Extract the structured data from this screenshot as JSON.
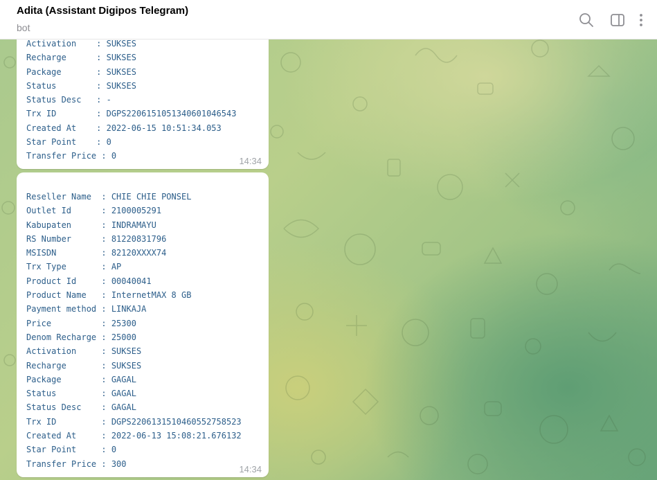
{
  "header": {
    "title": "Adita (Assistant Digipos Telegram)",
    "subtitle": "bot",
    "icons": {
      "search": "search-icon",
      "sidebar": "sidebar-toggle-icon",
      "more": "more-vertical-icon"
    }
  },
  "colors": {
    "message_text": "#2c5e8a",
    "bubble": "#ffffff",
    "time": "#a0a4a8",
    "background_light": "#cfd79a",
    "background_dark": "#5f9e74"
  },
  "messages": [
    {
      "lines": [
        "Activation    : SUKSES",
        "Recharge      : SUKSES",
        "Package       : SUKSES",
        "Status        : SUKSES",
        "Status Desc   : -",
        "Trx ID        : DGPS22061510513406010465​43",
        "Created At    : 2022-06-15 10:51:34.053",
        "Star Point    : 0",
        "Transfer Price : 0"
      ],
      "time": "14:34"
    },
    {
      "lines": [
        "Reseller Name  : CHIE CHIE PONSEL",
        "Outlet Id      : 2100005291",
        "Kabupaten      : INDRAMAYU",
        "RS Number      : 81220831796",
        "MSISDN         : 82120XXXX74",
        "Trx Type       : AP",
        "Product Id     : 00040041",
        "Product Name   : InternetMAX 8 GB",
        "Payment method : LINKAJA",
        "Price          : 25300",
        "Denom Recharge : 25000",
        "Activation     : SUKSES",
        "Recharge       : SUKSES",
        "Package        : GAGAL",
        "Status         : GAGAL",
        "Status Desc    : GAGAL",
        "Trx ID         : DGPS2206131510460552758523",
        "Created At     : 2022-06-13 15:08:21.676132",
        "Star Point     : 0",
        "Transfer Price : 300"
      ],
      "time": "14:34"
    }
  ]
}
